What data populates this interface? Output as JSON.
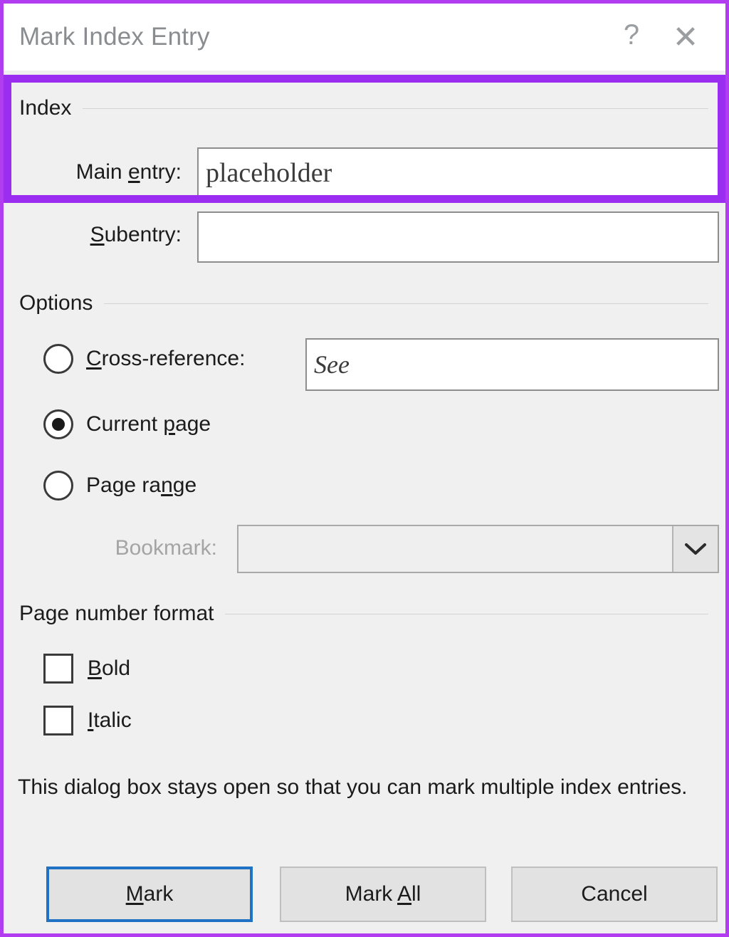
{
  "window": {
    "title": "Mark Index Entry",
    "help_icon": "question-mark-icon",
    "close_icon": "close-x-icon"
  },
  "highlight": {
    "color": "#9b2df0",
    "outer_border_color": "#b13cf0",
    "target": "index-group"
  },
  "sections": {
    "index": {
      "title": "Index",
      "main_entry": {
        "label_before": "Main ",
        "label_accel": "e",
        "label_after": "ntry:",
        "value": "placeholder",
        "placeholder": ""
      },
      "subentry": {
        "label_accel": "S",
        "label_after": "ubentry:",
        "value": "",
        "placeholder": ""
      }
    },
    "options": {
      "title": "Options",
      "cross_reference": {
        "label_accel": "C",
        "label_after": "ross-reference:",
        "selected": false,
        "value": "See",
        "placeholder": ""
      },
      "current_page": {
        "label_before": "Current ",
        "label_accel": "p",
        "label_after": "age",
        "selected": true
      },
      "page_range": {
        "label_before": "Page ra",
        "label_accel": "n",
        "label_after": "ge",
        "selected": false
      },
      "bookmark": {
        "label": "Bookmark:",
        "value": "",
        "disabled": true,
        "arrow_icon": "chevron-down-icon"
      }
    },
    "page_number_format": {
      "title": "Page number format",
      "bold": {
        "label_accel": "B",
        "label_after": "old",
        "checked": false
      },
      "italic": {
        "label_accel": "I",
        "label_after": "talic",
        "checked": false
      }
    }
  },
  "description": "This dialog box stays open so that you can mark multiple index entries.",
  "buttons": {
    "mark": {
      "label_accel": "M",
      "label_after": "ark",
      "is_default": true,
      "focus_color": "#1f72c4"
    },
    "mark_all": {
      "label_before": "Mark ",
      "label_accel": "A",
      "label_after": "ll",
      "is_default": false
    },
    "cancel": {
      "label": "Cancel",
      "is_default": false
    }
  }
}
